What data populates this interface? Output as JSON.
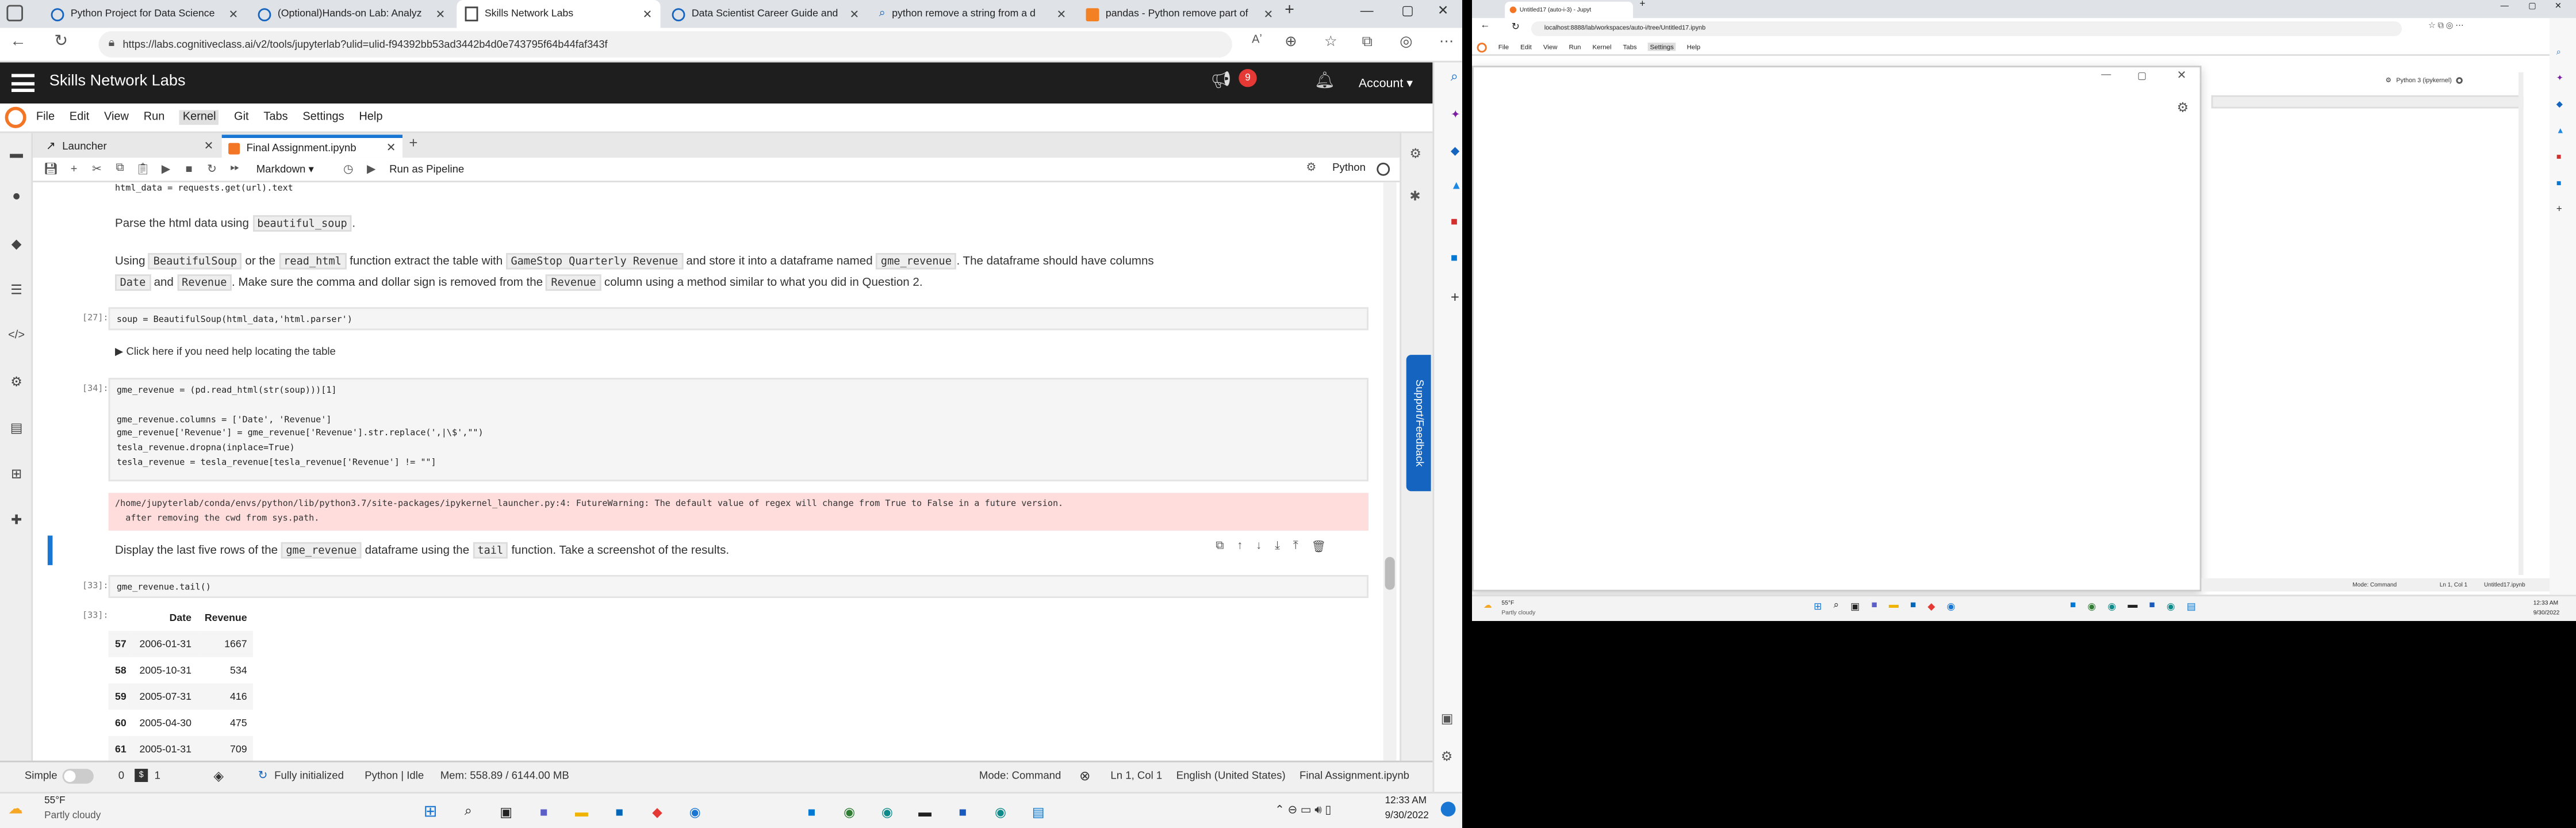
{
  "left_browser": {
    "tabs": [
      {
        "title": "Python Project for Data Science"
      },
      {
        "title": "(Optional)Hands-on Lab: Analyz"
      },
      {
        "title": "Skills Network Labs"
      },
      {
        "title": "Data Scientist Career Guide and"
      },
      {
        "title": "python remove a string from a d"
      },
      {
        "title": "pandas - Python remove part of"
      }
    ],
    "url": "https://labs.cognitiveclass.ai/v2/tools/jupyterlab?ulid=ulid-f94392bb53ad3442b4d0e743795f64b44faf343f",
    "reader_text": "Aʼ"
  },
  "skills": {
    "brand": "Skills Network Labs",
    "notif_count": "9",
    "account": "Account"
  },
  "jupyter": {
    "menu": [
      "File",
      "Edit",
      "View",
      "Run",
      "Kernel",
      "Git",
      "Tabs",
      "Settings",
      "Help"
    ],
    "tabs": [
      {
        "title": "Launcher"
      },
      {
        "title": "Final Assignment.ipynb"
      }
    ],
    "cell_type": "Markdown",
    "run_pipeline": "Run as Pipeline",
    "kernel": "Python",
    "support": "Support/Feedback",
    "cells": {
      "c0_code": "html_data = requests.get(url).text",
      "c1_text_a": "Parse the html data using ",
      "c1_code": "beautiful_soup",
      "c1_text_b": ".",
      "c2_l1_a": "Using ",
      "c2_l1_c1": "BeautifulSoup",
      "c2_l1_b": " or the ",
      "c2_l1_c2": "read_html",
      "c2_l1_c": " function extract the table with ",
      "c2_l1_c3": "GameStop Quarterly Revenue",
      "c2_l1_d": " and store it into a dataframe named ",
      "c2_l1_c4": "gme_revenue",
      "c2_l1_e": ". The dataframe should have columns",
      "c2_l2_c1": "Date",
      "c2_l2_a": " and ",
      "c2_l2_c2": "Revenue",
      "c2_l2_b": ". Make sure the comma and dollar sign is removed from the ",
      "c2_l2_c3": "Revenue",
      "c2_l2_c": " column using a method similar to what you did in Question 2.",
      "c3_prompt": "[27]:",
      "c3_code": "soup = BeautifulSoup(html_data,'html.parser')",
      "c4_details": "▶ Click here if you need help locating the table",
      "c5_prompt": "[34]:",
      "c5_code": "gme_revenue = (pd.read_html(str(soup)))[1]\n\ngme_revenue.columns = ['Date', 'Revenue']\ngme_revenue['Revenue'] = gme_revenue['Revenue'].str.replace(',|\\$',\"\")\ntesla_revenue.dropna(inplace=True)\ntesla_revenue = tesla_revenue[tesla_revenue['Revenue'] != \"\"]",
      "c5_warning": "/home/jupyterlab/conda/envs/python/lib/python3.7/site-packages/ipykernel_launcher.py:4: FutureWarning: The default value of regex will change from True to False in a future version.\n  after removing the cwd from sys.path.",
      "c6_a": "Display the last five rows of the ",
      "c6_c1": "gme_revenue",
      "c6_b": " dataframe using the ",
      "c6_c2": "tail",
      "c6_c": " function. Take a screenshot of the results.",
      "c7_prompt": "[33]:",
      "c7_code": "gme_revenue.tail()",
      "c8_prompt": "[33]:",
      "table": {
        "headers": [
          "",
          "Date",
          "Revenue"
        ],
        "rows": [
          [
            "57",
            "2006-01-31",
            "1667"
          ],
          [
            "58",
            "2005-10-31",
            "534"
          ],
          [
            "59",
            "2005-07-31",
            "416"
          ],
          [
            "60",
            "2005-04-30",
            "475"
          ],
          [
            "61",
            "2005-01-31",
            "709"
          ]
        ]
      }
    },
    "status": {
      "simple": "Simple",
      "zero": "0",
      "one": "1",
      "kernel_state": "Fully initialized",
      "kernel_name": "Python | Idle",
      "mem": "Mem: 558.89 / 6144.00 MB",
      "mode": "Mode: Command",
      "position": "Ln 1, Col 1",
      "lang": "English (United States)",
      "file": "Final Assignment.ipynb"
    }
  },
  "taskbar_left": {
    "temp": "55°F",
    "weather": "Partly cloudy",
    "time": "12:33 AM",
    "date": "9/30/2022"
  },
  "right_browser": {
    "tab_title": "Untitled17 (auto-i-3) - Jupyt",
    "url": "localhost:8888/lab/workspaces/auto-i/tree/Untitled17.ipynb",
    "menu": [
      "File",
      "Edit",
      "View",
      "Run",
      "Kernel",
      "Tabs",
      "Settings",
      "Help"
    ],
    "kernel": "Python 3 (ipykernel)",
    "status_mode": "Mode: Command",
    "status_pos": "Ln 1, Col 1",
    "status_file": "Untitled17.ipynb",
    "temp": "55°F",
    "weather": "Partly cloudy",
    "time": "12:33 AM",
    "date": "9/30/2022"
  },
  "colors": {
    "dark_header": "#1e1e1e",
    "jupyter_orange": "#f37626",
    "accent_blue": "#1976d2",
    "warning_bg": "#fdd"
  }
}
